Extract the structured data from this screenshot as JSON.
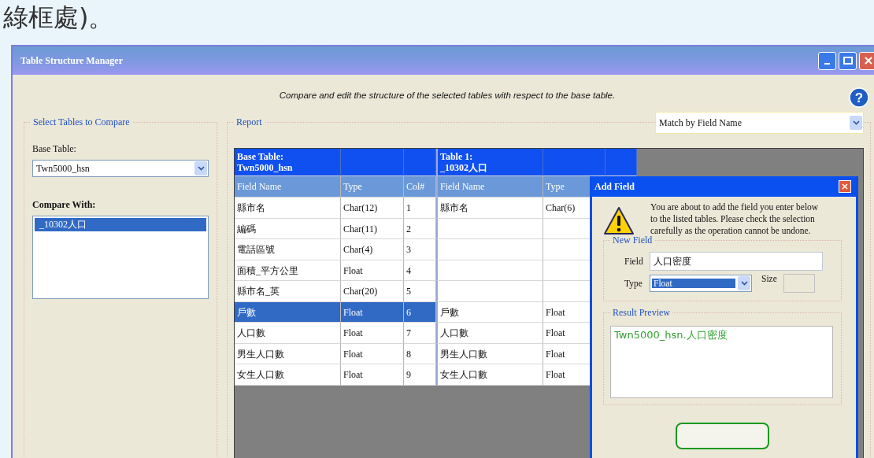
{
  "heading": "綠框處)。",
  "window": {
    "title": "Table Structure Manager",
    "help": "?",
    "description": "Compare and edit the structure of the selected tables with respect to the base table."
  },
  "select_group": {
    "legend": "Select Tables to Compare",
    "base_label": "Base Table:",
    "base_value": "Twn5000_hsn",
    "compare_label": "Compare With:",
    "compare_items": [
      {
        "label": "_10302人口",
        "selected": true
      }
    ]
  },
  "report": {
    "legend": "Report",
    "match_value": "Match by Field Name",
    "base_header": [
      "Base Table:",
      "Twn5000_hsn"
    ],
    "table1_header": [
      "Table 1:",
      "_10302人口"
    ],
    "columns": [
      "Field Name",
      "Type",
      "Col#",
      "Field Name",
      "Type"
    ],
    "rows": [
      {
        "field": "縣市名",
        "type": "Char(12)",
        "col": "1",
        "selected": false,
        "match": {
          "field": "縣市名",
          "type": "Char(6)"
        }
      },
      {
        "field": "編碼",
        "type": "Char(11)",
        "col": "2",
        "selected": false
      },
      {
        "field": "電話區號",
        "type": "Char(4)",
        "col": "3",
        "selected": false
      },
      {
        "field": "面積_平方公里",
        "type": "Float",
        "col": "4",
        "selected": false
      },
      {
        "field": "縣市名_英",
        "type": "Char(20)",
        "col": "5",
        "selected": false
      },
      {
        "field": "戶數",
        "type": "Float",
        "col": "6",
        "selected": true,
        "match": {
          "field": "戶數",
          "type": "Float"
        }
      },
      {
        "field": "人口數",
        "type": "Float",
        "col": "7",
        "selected": false,
        "match": {
          "field": "人口數",
          "type": "Float"
        }
      },
      {
        "field": "男生人口數",
        "type": "Float",
        "col": "8",
        "selected": false,
        "match": {
          "field": "男生人口數",
          "type": "Float"
        }
      },
      {
        "field": "女生人口數",
        "type": "Float",
        "col": "9",
        "selected": false,
        "match": {
          "field": "女生人口數",
          "type": "Float"
        }
      }
    ]
  },
  "dialog": {
    "title": "Add Field",
    "message": "You are about to add the field you enter below to the listed tables. Please check the selection carefully as the operation cannot be undone.",
    "new_field_legend": "New Field",
    "field_label": "Field",
    "field_value": "人口密度",
    "type_label": "Type",
    "type_value": "Float",
    "size_label": "Size",
    "preview_legend": "Result Preview",
    "preview_value": "Twn5000_hsn.人口密度"
  }
}
